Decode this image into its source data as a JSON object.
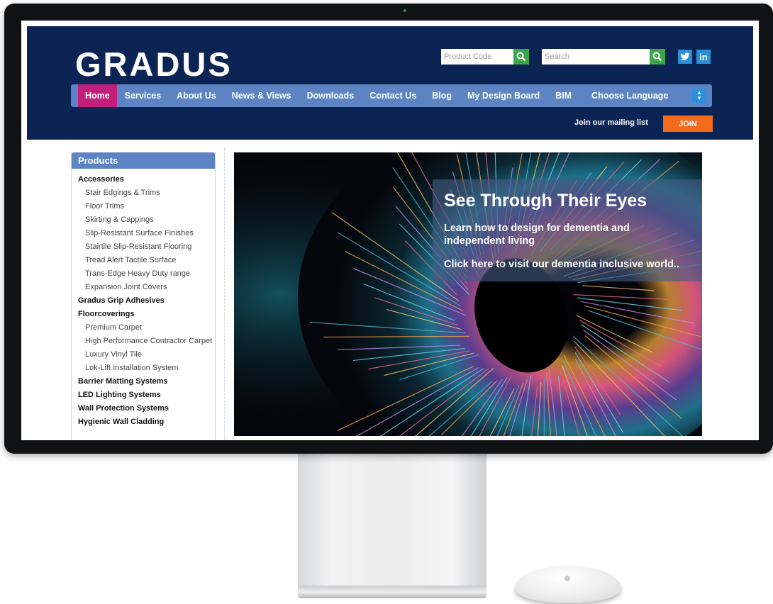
{
  "header": {
    "logo": "GRADUS",
    "product_code_placeholder": "Product Code",
    "search_placeholder": "Search",
    "mailing_label": "Join our mailing list",
    "join_label": "JOIN"
  },
  "nav": {
    "items": [
      "Home",
      "Services",
      "About Us",
      "News & Views",
      "Downloads",
      "Contact Us",
      "Blog",
      "My Design Board",
      "BIM"
    ],
    "language": "Choose Language"
  },
  "sidebar": {
    "title": "Products",
    "items": [
      {
        "label": "Accessories",
        "type": "category"
      },
      {
        "label": "Stair Edgings & Trims",
        "type": "sub"
      },
      {
        "label": "Floor Trims",
        "type": "sub"
      },
      {
        "label": "Skirting & Cappings",
        "type": "sub"
      },
      {
        "label": "Slip-Resistant Surface Finishes",
        "type": "sub"
      },
      {
        "label": "Stairtile Slip-Resistant Flooring",
        "type": "sub"
      },
      {
        "label": "Tread Alert Tactile Surface",
        "type": "sub"
      },
      {
        "label": "Trans-Edge Heavy Duty range",
        "type": "sub"
      },
      {
        "label": "Expansion Joint Covers",
        "type": "sub"
      },
      {
        "label": "Gradus Grip Adhesives",
        "type": "category"
      },
      {
        "label": "Floorcoverings",
        "type": "category"
      },
      {
        "label": "Premium Carpet",
        "type": "sub"
      },
      {
        "label": "High Performance Contractor Carpet",
        "type": "sub"
      },
      {
        "label": "Luxury Vinyl Tile",
        "type": "sub"
      },
      {
        "label": "Lok-Lift Installation System",
        "type": "sub"
      },
      {
        "label": "Barrier Matting Systems",
        "type": "category"
      },
      {
        "label": "LED Lighting Systems",
        "type": "category"
      },
      {
        "label": "Wall Protection Systems",
        "type": "category"
      },
      {
        "label": "Hygienic Wall Cladding",
        "type": "category"
      }
    ]
  },
  "hero": {
    "title": "See Through Their Eyes",
    "subtitle": "Learn how to design for dementia and independent living",
    "link": "Click here to visit our dementia inclusive world.."
  },
  "colors": {
    "header_bg": "#0b2453",
    "nav_bg": "#5c84c2",
    "nav_active": "#c21f7c",
    "search_button": "#3da64a",
    "join_button": "#f26b1d",
    "social": "#2a8fd6"
  },
  "icons": [
    "search-icon",
    "twitter-icon",
    "linkedin-icon",
    "select-arrows-icon"
  ]
}
